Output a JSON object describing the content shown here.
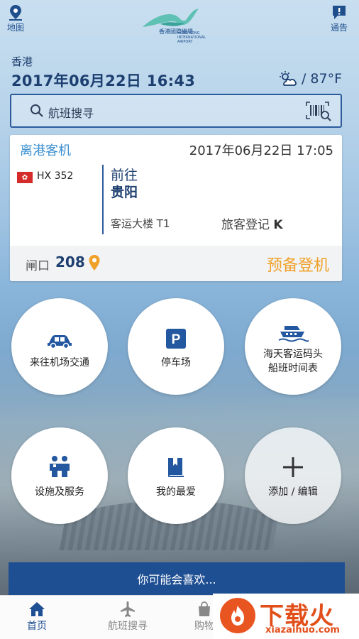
{
  "header": {
    "map_label": "地图",
    "notice_label": "通告",
    "logo_text": "HONG KONG INTERNATIONAL AIRPORT",
    "logo_text_zh": "香港國際機場"
  },
  "info": {
    "city": "香港",
    "datetime": "2017年06月22日 16:43",
    "weather": "/ 87°F"
  },
  "search": {
    "placeholder": "航班搜寻"
  },
  "flight_card": {
    "type": "离港客机",
    "date": "2017年06月22日 17:05",
    "flight_no": "HX 352",
    "to_label": "前往",
    "destination": "贵阳",
    "terminal": "客运大楼 T1",
    "checkin_label": "旅客登记",
    "checkin_row": "K",
    "gate_label": "闸口",
    "gate": "208",
    "status": "预备登机"
  },
  "shortcuts": [
    {
      "label": "来往机场交通",
      "icon": "car-icon"
    },
    {
      "label": "停车场",
      "icon": "parking-icon"
    },
    {
      "label": "海天客运码头\n船班时间表",
      "icon": "ferry-icon"
    },
    {
      "label": "设施及服务",
      "icon": "people-icon"
    },
    {
      "label": "我的最爱",
      "icon": "bookmark-book-icon"
    },
    {
      "label": "添加 / 编辑",
      "icon": "plus-icon"
    }
  ],
  "banner": {
    "text": "你可能会喜欢..."
  },
  "tabs": [
    {
      "label": "首页",
      "icon": "home-icon"
    },
    {
      "label": "航班搜寻",
      "icon": "plane-icon"
    },
    {
      "label": "购物",
      "icon": "shopping-icon"
    }
  ],
  "watermark": {
    "text": "下载火",
    "sub": "xiazaihuo.com"
  },
  "colors": {
    "primary": "#1f4f93",
    "accent": "#f0a12a",
    "light_blue": "#3a8fd0"
  }
}
